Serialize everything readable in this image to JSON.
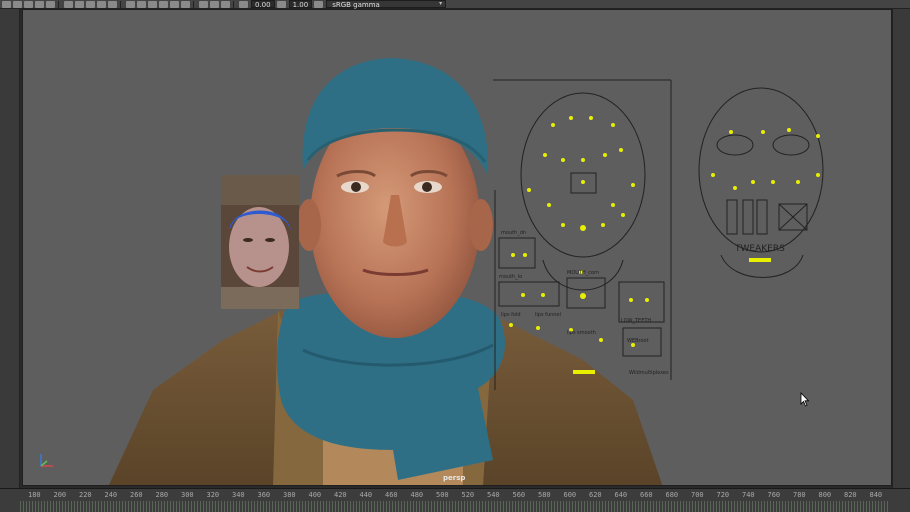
{
  "toolbar": {
    "field_a": "0.00",
    "field_b": "1.00",
    "colorspace": "sRGB gamma"
  },
  "viewport": {
    "camera": "persp"
  },
  "face_rig": {
    "panel_labels": [
      "mouth_dn",
      "mouth_lo",
      "lips fold",
      "lips funnel",
      "lips smooth",
      "MOUTH_corn",
      "LOW_TEETH",
      "WEBroot",
      "Wildmultiplexes"
    ],
    "tweakers_title": "TWEAKERS"
  },
  "timeline": {
    "ticks": [
      "180",
      "200",
      "220",
      "240",
      "260",
      "280",
      "300",
      "320",
      "340",
      "360",
      "380",
      "400",
      "420",
      "440",
      "460",
      "480",
      "500",
      "520",
      "540",
      "560",
      "580",
      "600",
      "620",
      "640",
      "660",
      "680",
      "700",
      "720",
      "740",
      "760",
      "780",
      "800",
      "820",
      "840"
    ]
  },
  "colors": {
    "viewport_bg": "#5e5e5e",
    "rig_yellow": "#e8f000",
    "hat_blue": "#2f6f86",
    "coat_brown": "#6f5534"
  }
}
